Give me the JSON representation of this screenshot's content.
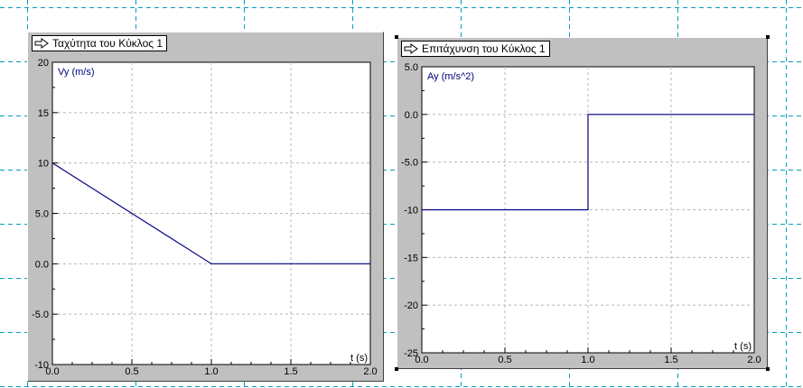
{
  "chart_data": [
    {
      "type": "line",
      "title": "Ταχύτητα  του Κύκλος 1",
      "xlabel": "t (s)",
      "ylabel": "Vy (m/s)",
      "xlim": [
        0.0,
        2.0
      ],
      "ylim": [
        -10,
        20
      ],
      "x_ticks": [
        "0.0",
        "0.5",
        "1.0",
        "1.5",
        "2.0"
      ],
      "y_ticks": [
        "-10",
        "-5.0",
        "0.0",
        "5.0",
        "10",
        "15",
        "20"
      ],
      "grid": true,
      "series": [
        {
          "x": [
            0.0,
            1.0,
            2.0
          ],
          "y": [
            10,
            0,
            0
          ],
          "color": "#00007f"
        }
      ]
    },
    {
      "type": "line",
      "title": "Επιτάχυνση του Κύκλος 1",
      "xlabel": "t (s)",
      "ylabel": "Ay (m/s^2)",
      "xlim": [
        0.0,
        2.0
      ],
      "ylim": [
        -25,
        5
      ],
      "x_ticks": [
        "0.0",
        "0.5",
        "1.0",
        "1.5",
        "2.0"
      ],
      "y_ticks": [
        "-25",
        "-20",
        "-15",
        "-10",
        "-5.0",
        "0.0",
        "5.0"
      ],
      "grid": true,
      "series": [
        {
          "x": [
            0.0,
            1.0,
            1.0,
            2.0
          ],
          "y": [
            -10,
            -10,
            0,
            0
          ],
          "color": "#00007f"
        }
      ]
    }
  ],
  "ui": {
    "arrow_icon": "arrow-right-icon"
  }
}
